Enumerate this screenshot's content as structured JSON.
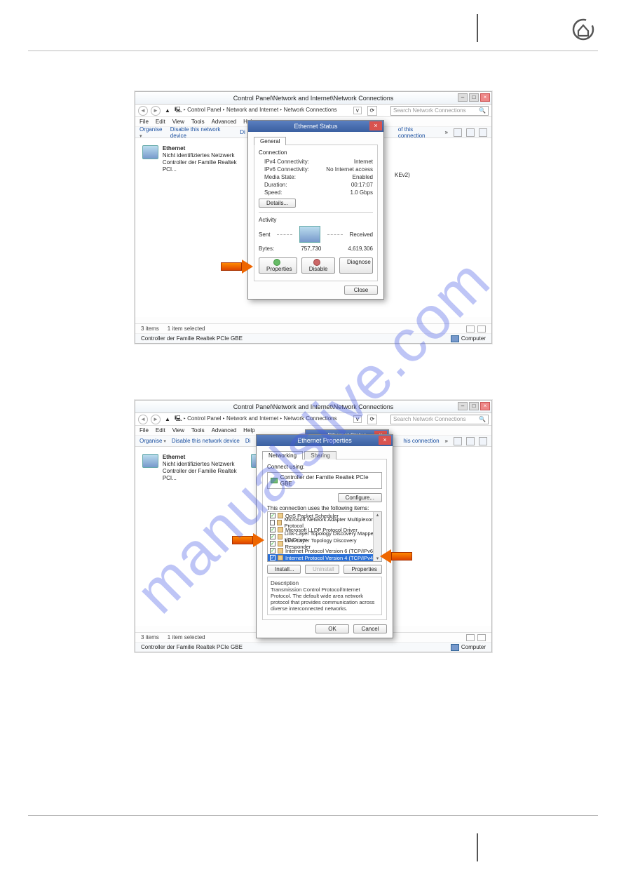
{
  "window": {
    "title": "Control Panel\\Network and Internet\\Network Connections",
    "breadcrumb_parts": [
      "Control Panel",
      "Network and Internet",
      "Network Connections"
    ],
    "search_placeholder": "Search Network Connections",
    "menus": {
      "file": "File",
      "edit": "Edit",
      "view": "View",
      "tools": "Tools",
      "advanced": "Advanced",
      "help": "Help"
    },
    "toolbar": {
      "organise": "Organise",
      "disable": "Disable this network device",
      "diagnose_frag": "Di",
      "right_frag": "of this connection",
      "right_frag2": "his connection",
      "more": "»"
    },
    "adapter1": {
      "name": "Ethernet",
      "sub1": "Nicht identifiziertes Netzwerk",
      "sub2": "Controller der Familie Realtek PCI..."
    },
    "adapter2_suffix": "KEv2)",
    "status": {
      "items": "3 items",
      "selected": "1 item selected"
    },
    "footer_left": "Controller der Familie Realtek PCIe GBE",
    "footer_right": "Computer"
  },
  "dialog_status": {
    "title": "Ethernet Status",
    "tab_general": "General",
    "group_conn": "Connection",
    "ipv4_k": "IPv4 Connectivity:",
    "ipv4_v": "Internet",
    "ipv6_k": "IPv6 Connectivity:",
    "ipv6_v": "No Internet access",
    "media_k": "Media State:",
    "media_v": "Enabled",
    "dur_k": "Duration:",
    "dur_v": "00:17:07",
    "speed_k": "Speed:",
    "speed_v": "1.0 Gbps",
    "details_btn": "Details...",
    "group_act": "Activity",
    "sent": "Sent",
    "received": "Received",
    "bytes_k": "Bytes:",
    "bytes_sent": "757,730",
    "bytes_recv": "4,619,306",
    "props_btn": "Properties",
    "disable_btn": "Disable",
    "diag_btn": "Diagnose",
    "close_btn": "Close"
  },
  "dialog_props": {
    "title": "Ethernet Properties",
    "title_behind": "Ethernet Status",
    "tab_net": "Networking",
    "tab_share": "Sharing",
    "connect_using": "Connect using:",
    "nic": "Controller der Familie Realtek PCIe GBE",
    "configure_btn": "Configure...",
    "items_label": "This connection uses the following items:",
    "items": {
      "i0": "QoS Packet Scheduler",
      "i1": "Microsoft Network Adapter Multiplexor Protocol",
      "i2": "Microsoft LLDP Protocol Driver",
      "i3": "Link-Layer Topology Discovery Mapper I/O Driver",
      "i4": "Link-Layer Topology Discovery Responder",
      "i5": "Internet Protocol Version 6 (TCP/IPv6)",
      "i6": "Internet Protocol Version 4 (TCP/IPv4)"
    },
    "install_btn": "Install...",
    "uninstall_btn": "Uninstall",
    "props_btn": "Properties",
    "desc_label": "Description",
    "desc_text": "Transmission Control Protocol/Internet Protocol. The default wide area network protocol that provides communication across diverse interconnected networks.",
    "ok_btn": "OK",
    "cancel_btn": "Cancel"
  },
  "watermark": "manualslive.com"
}
